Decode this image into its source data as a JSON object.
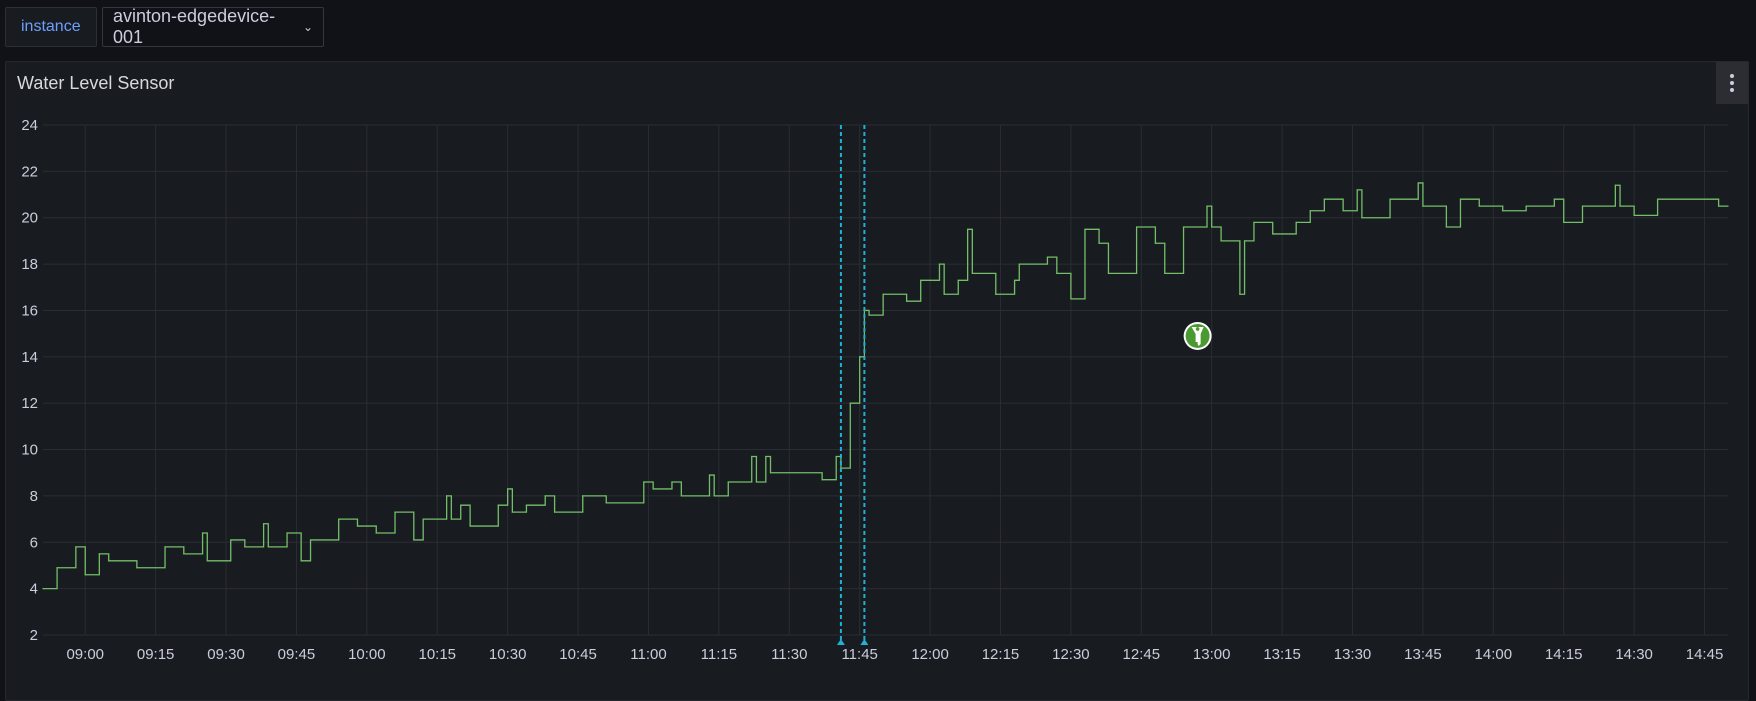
{
  "variables": {
    "label": "instance",
    "value": "avinton-edgedevice-001"
  },
  "panel": {
    "title": "Water Level Sensor",
    "menu_icon": "kebab-menu-icon"
  },
  "colors": {
    "series": "#73bf69",
    "annotation": "#1fb2d6",
    "grid": "#2a2d33",
    "background": "#181b1f"
  },
  "chart_data": {
    "type": "line",
    "interpolation": "step-after",
    "title": "Water Level Sensor",
    "xlabel": "",
    "ylabel": "",
    "x_range": [
      "08:51",
      "14:50"
    ],
    "ylim": [
      2,
      24
    ],
    "y_ticks": [
      "2",
      "4",
      "6",
      "8",
      "10",
      "12",
      "14",
      "16",
      "18",
      "20",
      "22",
      "24"
    ],
    "x_ticks": [
      "09:00",
      "09:15",
      "09:30",
      "09:45",
      "10:00",
      "10:15",
      "10:30",
      "10:45",
      "11:00",
      "11:15",
      "11:30",
      "11:45",
      "12:00",
      "12:15",
      "12:30",
      "12:45",
      "13:00",
      "13:15",
      "13:30",
      "13:45",
      "14:00",
      "14:15",
      "14:30",
      "14:45"
    ],
    "grid": true,
    "legend": "none",
    "annotations": [
      "11:41",
      "11:46"
    ],
    "marker": {
      "icon": "key-icon",
      "x": "12:57",
      "y": 14.9
    },
    "series": [
      {
        "x": [
          "08:51",
          "08:54",
          "08:58",
          "09:00",
          "09:03",
          "09:05",
          "09:11",
          "09:17",
          "09:21",
          "09:25",
          "09:26",
          "09:31",
          "09:34",
          "09:38",
          "09:39",
          "09:43",
          "09:46",
          "09:48",
          "09:54",
          "09:58",
          "10:02",
          "10:06",
          "10:10",
          "10:12",
          "10:17",
          "10:18",
          "10:20",
          "10:22",
          "10:28",
          "10:30",
          "10:31",
          "10:34",
          "10:38",
          "10:40",
          "10:46",
          "10:51",
          "10:59",
          "11:01",
          "11:05",
          "11:07",
          "11:13",
          "11:14",
          "11:17",
          "11:22",
          "11:23",
          "11:25",
          "11:26",
          "11:37",
          "11:40",
          "11:41",
          "11:43",
          "11:45",
          "11:46",
          "11:47",
          "11:50",
          "11:55",
          "11:58",
          "12:02",
          "12:03",
          "12:06",
          "12:08",
          "12:09",
          "12:14",
          "12:18",
          "12:19",
          "12:25",
          "12:27",
          "12:30",
          "12:33",
          "12:36",
          "12:38",
          "12:44",
          "12:48",
          "12:50",
          "12:54",
          "12:59",
          "13:00",
          "13:02",
          "13:06",
          "13:07",
          "13:09",
          "13:13",
          "13:18",
          "13:21",
          "13:24",
          "13:28",
          "13:31",
          "13:32",
          "13:38",
          "13:44",
          "13:45",
          "13:50",
          "13:53",
          "13:57",
          "14:02",
          "14:07",
          "14:13",
          "14:15",
          "14:19",
          "14:26",
          "14:27",
          "14:30",
          "14:35",
          "14:48",
          "14:50"
        ],
        "values": [
          4.0,
          4.9,
          5.8,
          4.6,
          5.5,
          5.2,
          4.9,
          5.8,
          5.5,
          6.4,
          5.2,
          6.1,
          5.8,
          6.8,
          5.8,
          6.4,
          5.2,
          6.1,
          7.0,
          6.7,
          6.4,
          7.3,
          6.1,
          7.0,
          8.0,
          7.0,
          7.6,
          6.7,
          7.6,
          8.3,
          7.3,
          7.6,
          8.0,
          7.3,
          8.0,
          7.7,
          8.6,
          8.3,
          8.6,
          8.0,
          8.9,
          8.0,
          8.6,
          9.7,
          8.6,
          9.7,
          9.0,
          8.7,
          9.7,
          9.2,
          12.0,
          14.0,
          16.0,
          15.8,
          16.7,
          16.4,
          17.3,
          18.0,
          16.7,
          17.3,
          19.5,
          17.6,
          16.7,
          17.3,
          18.0,
          18.3,
          17.6,
          16.5,
          19.5,
          18.9,
          17.6,
          19.6,
          18.9,
          17.6,
          19.6,
          20.5,
          19.6,
          19.0,
          16.7,
          19.0,
          19.8,
          19.3,
          19.8,
          20.3,
          20.8,
          20.3,
          21.2,
          20.0,
          20.8,
          21.5,
          20.5,
          19.6,
          20.8,
          20.5,
          20.3,
          20.5,
          20.8,
          19.8,
          20.5,
          21.4,
          20.5,
          20.1,
          20.8,
          20.5,
          20.5
        ]
      }
    ]
  }
}
